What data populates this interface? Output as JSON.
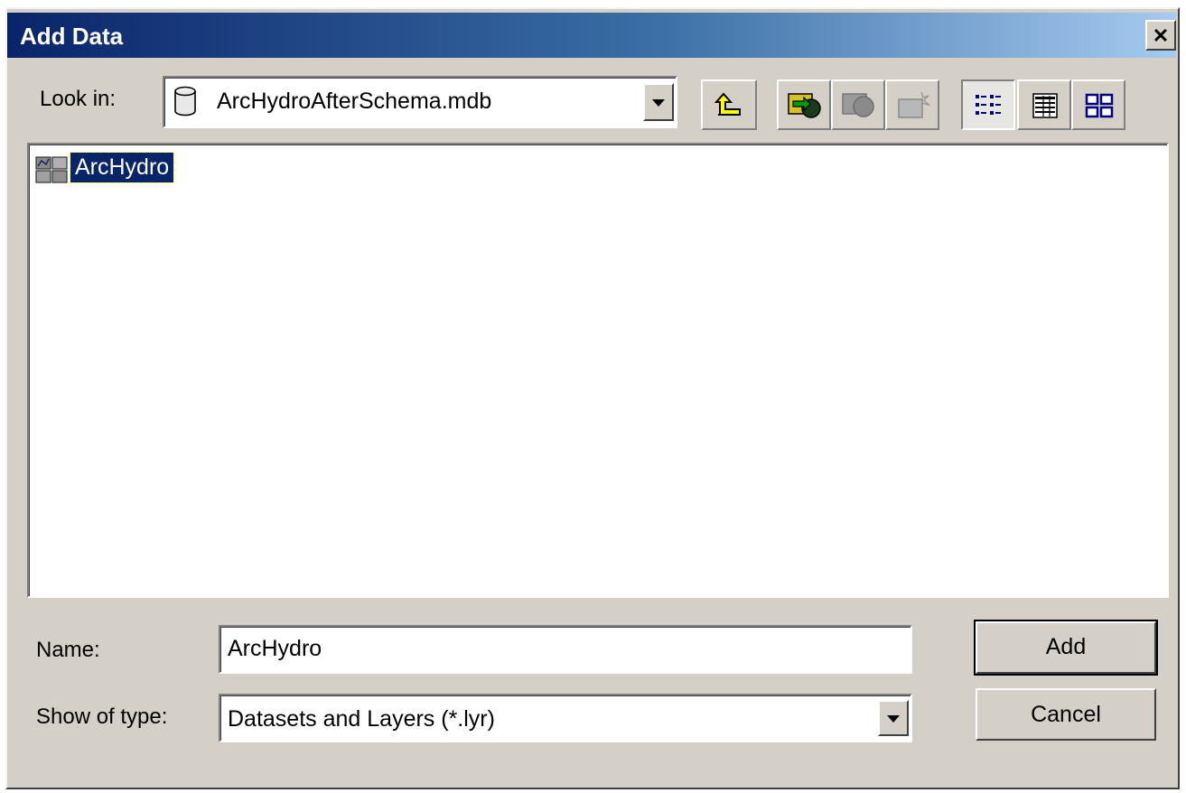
{
  "window": {
    "title": "Add Data",
    "close_glyph": "✕"
  },
  "look_in": {
    "label": "Look in:",
    "value": "ArcHydroAfterSchema.mdb",
    "icon": "database-icon"
  },
  "toolbar": {
    "buttons": [
      {
        "name": "up-one-level",
        "icon": "folder-up-icon",
        "enabled": true
      },
      {
        "name": "connect-to-folder",
        "icon": "connect-folder-icon",
        "enabled": true
      },
      {
        "name": "disconnect-from-folder",
        "icon": "disconnect-folder-icon",
        "enabled": false
      },
      {
        "name": "new-folder",
        "icon": "new-folder-icon",
        "enabled": false
      },
      {
        "name": "list-view",
        "icon": "list-view-icon",
        "pressed": true
      },
      {
        "name": "details-view",
        "icon": "details-view-icon",
        "pressed": false
      },
      {
        "name": "thumbnails-view",
        "icon": "thumbnails-view-icon",
        "pressed": false
      }
    ]
  },
  "file_list": {
    "items": [
      {
        "label": "ArcHydro",
        "icon": "feature-dataset-icon",
        "selected": true
      }
    ]
  },
  "name_field": {
    "label": "Name:",
    "value": "ArcHydro"
  },
  "type_field": {
    "label": "Show of type:",
    "value": "Datasets and Layers (*.lyr)"
  },
  "buttons": {
    "add": "Add",
    "cancel": "Cancel"
  },
  "colors": {
    "face": "#d4d0c8",
    "title_start": "#0a246a",
    "title_end": "#a6caf0",
    "selection": "#0a246a"
  }
}
